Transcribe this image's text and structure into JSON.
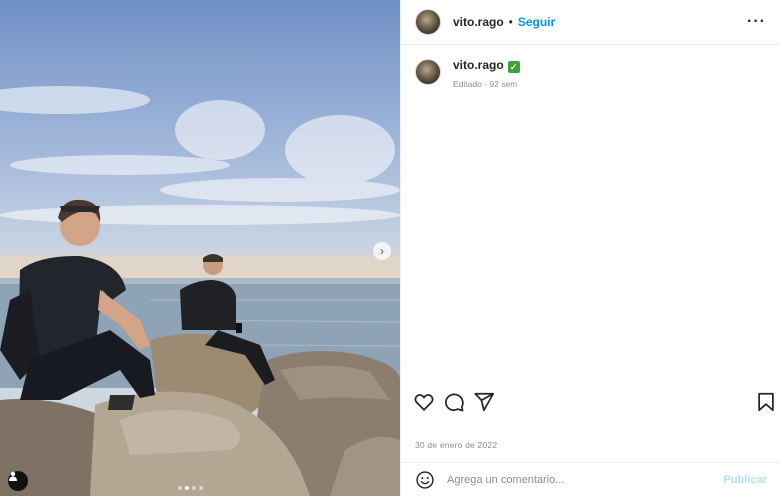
{
  "post": {
    "username": "vito.rago",
    "separator": "•",
    "follow_label": "Seguir",
    "more_label": "···",
    "caption_badge": "✓",
    "caption_meta": "Editado · 92 sem",
    "date": "30 de enero de 2022"
  },
  "media": {
    "next_label": "›",
    "slide_index": 2,
    "slide_count": 4
  },
  "comment": {
    "placeholder": "Agrega un comentario...",
    "publish_label": "Publicar"
  },
  "colors": {
    "accent": "#0095f6",
    "publish_disabled": "#b2dffc",
    "verified_badge": "#3aa33a"
  },
  "icons": [
    "heart-icon",
    "comment-icon",
    "share-icon",
    "bookmark-icon",
    "emoji-icon",
    "user-tag-icon",
    "chevron-right-icon"
  ]
}
